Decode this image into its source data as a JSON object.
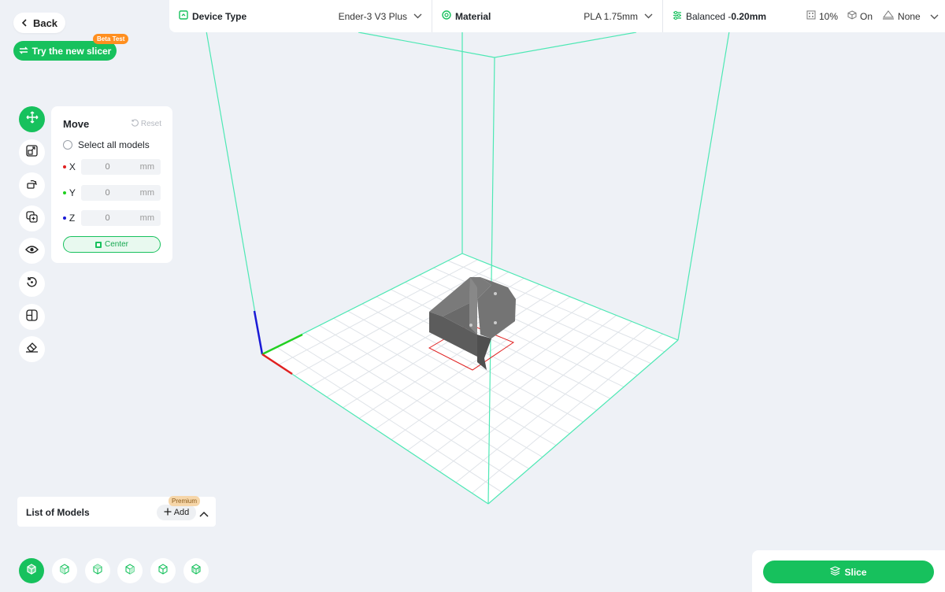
{
  "nav": {
    "back_label": "Back",
    "slicer_label": "Try the new slicer",
    "beta_label": "Beta Test"
  },
  "topbar": {
    "device_label": "Device Type",
    "device_value": "Ender-3 V3 Plus",
    "material_label": "Material",
    "material_value": "PLA 1.75mm",
    "profile_prefix": "Balanced - ",
    "profile_value": "0.20mm",
    "infill_value": "10%",
    "support_value": "On",
    "adhesion_value": "None"
  },
  "move_panel": {
    "title": "Move",
    "reset_label": "Reset",
    "select_all_label": "Select all models",
    "axes": [
      {
        "label": "X",
        "value": "0",
        "unit": "mm",
        "color": "#e02020"
      },
      {
        "label": "Y",
        "value": "0",
        "unit": "mm",
        "color": "#1fd01f"
      },
      {
        "label": "Z",
        "value": "0",
        "unit": "mm",
        "color": "#1a1ad6"
      }
    ],
    "center_label": "Center"
  },
  "models": {
    "title": "List of Models",
    "add_label": "Add",
    "premium_label": "Premium"
  },
  "slice": {
    "label": "Slice"
  },
  "colors": {
    "accent": "#17c15d",
    "build_volume": "#4de8b4",
    "badge_orange": "#ff8f1f"
  }
}
